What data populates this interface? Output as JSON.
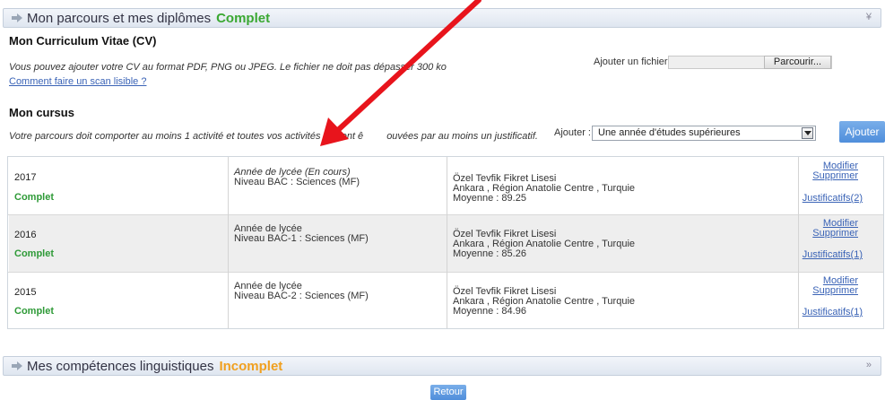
{
  "section1": {
    "title": "Mon parcours et mes diplômes",
    "status": "Complet",
    "status_color": "#3aa832",
    "chevron": "¥"
  },
  "cv": {
    "heading": "Mon Curriculum Vitae (CV)",
    "description": "Vous pouvez ajouter votre CV au format PDF, PNG ou JPEG. Le fichier ne doit pas dépasser 300 ko",
    "scan_link": "Comment faire un scan lisible ?",
    "add_file_label": "Ajouter un fichier",
    "browse_label": "Parcourir..."
  },
  "cursus": {
    "heading": "Mon cursus",
    "description_part1": "Votre parcours doit comporter au moins 1 activité et toutes vos activités doivent ê",
    "description_part2": "ouvées par au moins un justificatif.",
    "add_label": "Ajouter :",
    "select_value": "Une année d'études supérieures",
    "add_button": "Ajouter"
  },
  "table": {
    "rows": [
      {
        "year": "2017",
        "status": "Complet",
        "type": "Année de lycée (En cours)",
        "level": "Niveau BAC : Sciences (MF)",
        "school": "Özel Tevfik Fikret Lisesi",
        "location": "Ankara , Région Anatolie Centre , Turquie",
        "average": "Moyenne : 89.25",
        "modify": "Modifier",
        "delete": "Supprimer",
        "justifs": "Justificatifs(2)"
      },
      {
        "year": "2016",
        "status": "Complet",
        "type": "Année de lycée",
        "level": "Niveau BAC-1 : Sciences (MF)",
        "school": "Özel Tevfik Fikret Lisesi",
        "location": "Ankara , Région Anatolie Centre , Turquie",
        "average": "Moyenne : 85.26",
        "modify": "Modifier",
        "delete": "Supprimer",
        "justifs": "Justificatifs(1)"
      },
      {
        "year": "2015",
        "status": "Complet",
        "type": "Année de lycée",
        "level": "Niveau BAC-2 : Sciences (MF)",
        "school": "Özel Tevfik Fikret Lisesi",
        "location": "Ankara , Région Anatolie Centre , Turquie",
        "average": "Moyenne : 84.96",
        "modify": "Modifier",
        "delete": "Supprimer",
        "justifs": "Justificatifs(1)"
      }
    ]
  },
  "section2": {
    "title": "Mes compétences linguistiques",
    "status": "Incomplet",
    "status_color": "#f0a020",
    "chevron": "»"
  },
  "back_button": "Retour",
  "colors": {
    "accent_blue": "#5b97df",
    "link": "#3a63b6",
    "annotation_arrow": "#e8141c"
  }
}
